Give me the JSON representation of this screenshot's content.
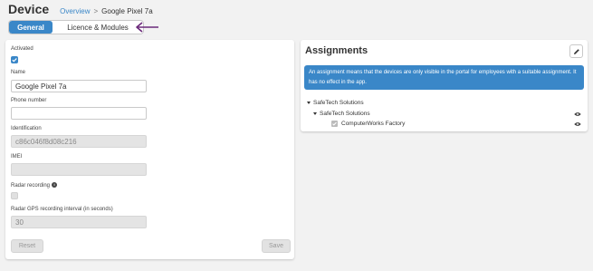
{
  "header": {
    "title": "Device",
    "breadcrumb": {
      "link": "Overview",
      "separator": ">",
      "current": "Google Pixel 7a"
    }
  },
  "tabs": [
    {
      "label": "General",
      "active": true
    },
    {
      "label": "Licence & Modules",
      "active": false
    }
  ],
  "form": {
    "activated": {
      "label": "Activated",
      "checked": true
    },
    "name": {
      "label": "Name",
      "value": "Google Pixel 7a"
    },
    "phone": {
      "label": "Phone number",
      "value": ""
    },
    "identification": {
      "label": "Identification",
      "value": "c86c046f8d08c216"
    },
    "imei": {
      "label": "IMEI",
      "value": ""
    },
    "radar_recording": {
      "label": "Radar recording",
      "checked": false,
      "icon": "info-icon"
    },
    "radar_interval": {
      "label": "Radar GPS recording interval (in seconds)",
      "value": "30"
    },
    "reset_label": "Reset",
    "save_label": "Save"
  },
  "assignments": {
    "title": "Assignments",
    "notice": "An assignment means that the devices are only visible in the portal for employees with a suitable assignment. It has no effect in the app.",
    "tree": [
      {
        "label": "SafeTech Solutions",
        "level": 0,
        "expanded": true
      },
      {
        "label": "SafeTech Solutions",
        "level": 1,
        "expanded": true,
        "visible_icon": "eye-icon"
      },
      {
        "label": "ComputerWorks Factory",
        "level": 2,
        "checked": true,
        "visible_icon": "eye-icon"
      }
    ]
  },
  "colors": {
    "accent": "#3a87c8",
    "annotation_arrow": "#6b2a7a"
  }
}
